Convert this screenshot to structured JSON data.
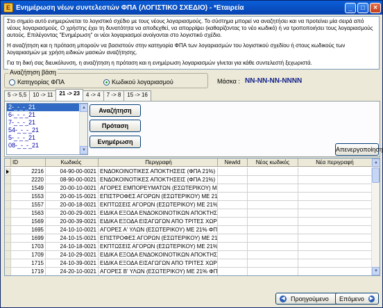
{
  "window": {
    "title": "Ενημέρωση νέων συντελεστών ΦΠΑ (ΛΟΓΙΣΤΙΚΟ ΣΧΕΔΙΟ) - *Εταιρεία",
    "minimize": "_",
    "maximize": "□",
    "close": "×"
  },
  "info": {
    "p1": "Στο σημείο αυτό ενημερώνεται το λογιστικό σχέδιο με τους νέους λογαριασμούς. Το σύστημα μπορεί να αναζητήσει και να προτείνει μία σειρά από νέους λογαριασμούς. Ο χρήστης έχει τη δυνατότητα να αποδεχθεί, να απορρίψει (καθαρίζοντας το νέο κωδικό) ή να τροποποιήσει τους λογαριασμούς αυτούς. Επιλέγοντας \"Ενημέρωση\" οι νέοι λογαριασμοί ανοίγονται στο λογιστικό σχέδιο.",
    "p2": "Η αναζήτηση και η πρόταση μπορούν να βασιστούν στην κατηγορία ΦΠΑ των λογαριασμών του λογιστικού σχεδίου ή στους κωδικούς των λογαριασμών με χρήση ειδικών μασκών αναζήτησης.",
    "p3": "Για τη δική σας διευκόλυνση, η αναζήτηση η πρόταση και η ενημέρωση λογαριασμών γίνεται για κάθε συντελεστή ξεχωριστά."
  },
  "search_basis": {
    "legend": "Αναζήτηση βάση",
    "option_category": "Κατηγορίας ΦΠΑ",
    "option_code": "Κωδικού λογαριασμού",
    "selected": "code"
  },
  "mask": {
    "label": "Μάσκα :",
    "value": "NN-NN-NN-NNNN"
  },
  "tabs": [
    "5 -> 5,5",
    "10 -> 11",
    "21 -> 23",
    "4 -> 4",
    "7 -> 8",
    "15 -> 16"
  ],
  "active_tab": 2,
  "code_list": [
    "2-_-_-_21",
    "6-_-_-_21",
    "7-_-_-_21",
    "54-_-_-_21",
    "5-_-_-_21",
    "08-_-_-_21"
  ],
  "buttons": {
    "search": "Αναζήτηση",
    "suggest": "Πρόταση",
    "update": "Ενημέρωση",
    "deactivate": "Απενεργοποίηση",
    "previous": "Προηγούμενο",
    "next": "Επόμενο"
  },
  "grid": {
    "headers": [
      "ID",
      "Κωδικός",
      "Περιγραφή",
      "NewId",
      "Νέος κωδικός",
      "Νέα περιγραφή"
    ],
    "rows": [
      [
        "2216",
        "04-90-00-0021",
        "ΕΝΔΟΚΟΙΝΟΤΙΚΕΣ ΑΠΟΚΤΗΣΕΙΣ (ΦΠΑ 21%)"
      ],
      [
        "2220",
        "08-90-00-0021",
        "ΕΝΔΟΚΟΙΝΟΤΙΚΕΣ ΑΠΟΚΤΗΣΕΙΣ (ΦΠΑ 21%)"
      ],
      [
        "1549",
        "20-00-10-0021",
        "ΑΓΟΡΕΣ ΕΜΠΟΡΕΥΜΑΤΩΝ (ΕΣΩΤΕΡΙΚΟΥ) ΜΕ 21% ΦΠΑ"
      ],
      [
        "1553",
        "20-00-15-0021",
        "ΕΠΙΣΤΡΟΦΕΣ ΑΓΟΡΩΝ (ΕΣΩΤΕΡΙΚΟΥ) ΜΕ 21% ΦΠΑ"
      ],
      [
        "1557",
        "20-00-18-0021",
        "ΕΚΠΤΩΣΕΙΣ ΑΓΟΡΩΝ (ΕΣΩΤΕΡΙΚΟΥ) ΜΕ 21% ΦΠΑ"
      ],
      [
        "1563",
        "20-00-29-0021",
        "ΕΙΔΙΚΑ ΕΞΟΔΑ ΕΝΔΟΚΟΙΝΟΤΙΚΩΝ ΑΠΟΚΤΗΣΕΩΝ ΜΕ 21"
      ],
      [
        "1569",
        "20-00-39-0021",
        "ΕΙΔΙΚΑ ΕΞΟΔΑ ΕΙΣΑΓΩΓΩΝ ΑΠΟ ΤΡΙΤΕΣ ΧΩΡΕΣ ΜΕ 21"
      ],
      [
        "1695",
        "24-10-10-0021",
        "ΑΓΟΡΕΣ Α' ΥΛΩΝ (ΕΣΩΤΕΡΙΚΟΥ) ΜΕ 21% ΦΠΑ"
      ],
      [
        "1699",
        "24-10-15-0021",
        "ΕΠΙΣΤΡΟΦΕΣ ΑΓΟΡΩΝ (ΕΣΩΤΕΡΙΚΟΥ) ΜΕ 21% ΦΠΑ"
      ],
      [
        "1703",
        "24-10-18-0021",
        "ΕΚΠΤΩΣΕΙΣ ΑΓΟΡΩΝ (ΕΣΩΤΕΡΙΚΟΥ) ΜΕ 21% ΦΠΑ"
      ],
      [
        "1709",
        "24-10-29-0021",
        "ΕΙΔΙΚΑ ΕΞΟΔΑ ΕΝΔΟΚΟΙΝΟΤΙΚΩΝ ΑΠΟΚΤΗΣΕΩΝ ΜΕ 21"
      ],
      [
        "1715",
        "24-10-39-0021",
        "ΕΙΔΙΚΑ ΕΞΟΔΑ ΕΙΣΑΓΩΓΩΝ ΑΠΟ ΤΡΙΤΕΣ ΧΩΡΕΣ ΜΕ 21"
      ],
      [
        "1719",
        "24-20-10-0021",
        "ΑΓΟΡΕΣ Β' ΥΛΩΝ (ΕΣΩΤΕΡΙΚΟΥ) ΜΕ 21% ΦΠΑ"
      ]
    ],
    "current_row": 0
  }
}
